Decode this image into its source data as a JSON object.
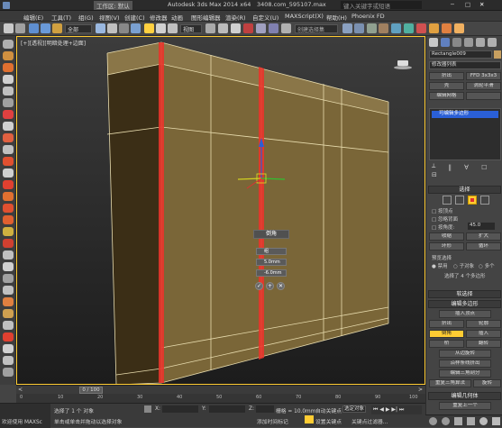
{
  "titlebar": {
    "workspace": "工作区: 默认",
    "app_title": "Autodesk 3ds Max 2014 x64",
    "file_name": "3408.com_595107.max",
    "search_placeholder": "键入关键字或短语"
  },
  "menu": [
    "编辑(E)",
    "工具(T)",
    "组(G)",
    "视图(V)",
    "创建(C)",
    "修改器",
    "动画",
    "图形编辑器",
    "渲染(R)",
    "自定义(U)",
    "MAXScript(X)",
    "帮助(H)",
    "Phoenix FD"
  ],
  "toolbar": {
    "selection_filter": "全部",
    "view_dropdown": "视图",
    "named_selection": "创建选择集"
  },
  "viewport": {
    "label": "[+][透视][明暗处理+边面]"
  },
  "caddy": {
    "title": "倒角",
    "row1": "组",
    "row2": "5.0mm",
    "row3": "-6.0mm"
  },
  "command_panel": {
    "object_name": "Rectangle009",
    "modifier_list": "修改器列表",
    "btns": [
      "挤出",
      "FFD 3x3x3",
      "壳",
      "涡轮平滑",
      "编辑网格",
      "",
      "UVW 贴图",
      ""
    ],
    "stack_item": "可编辑多边形",
    "selection_header": "选择",
    "by_vertex": "按顶点",
    "ignore_backfacing": "忽略背面",
    "by_angle": "按角度:",
    "angle_value": "45.0",
    "shrink": "收缩",
    "grow": "扩大",
    "ring": "环形",
    "loop": "循环",
    "preview_selection": "预览选择",
    "preview_off": "禁用",
    "preview_subobj": "子对象",
    "preview_multi": "多个",
    "selection_info": "选择了 4 个多边形",
    "soft_selection": "软选择",
    "edit_polygons": "编辑多边形",
    "insert_vertex": "插入顶点",
    "extrude": "挤出",
    "outline": "轮廓",
    "bevel": "倒角",
    "inset": "插入",
    "bridge": "桥",
    "flip": "翻转",
    "from_edge": "从边旋转",
    "hinge_along_spline": "沿样条线挤出",
    "edit_triangulation": "编辑三角剖分",
    "retriangulate": "重复三角算法",
    "turn": "旋转",
    "edit_geometry": "编辑几何体",
    "repeat_last": "重复上一个"
  },
  "timeline": {
    "frame": "0 / 100",
    "ticks": [
      "0",
      "10",
      "20",
      "30",
      "40",
      "50",
      "60",
      "70",
      "80",
      "90",
      "100"
    ]
  },
  "status": {
    "selected": "选择了 1 个 对象",
    "prompt": "单击或单击并拖动以选择对象",
    "welcome": "欢迎使用 MAXSc",
    "x_label": "X:",
    "y_label": "Y:",
    "z_label": "Z:",
    "grid": "栅格 = 10.0mm",
    "auto_key": "自动关键点",
    "set_key": "设置关键点",
    "key_filter": "选定对象",
    "key_filters_btn": "关键点过滤器...",
    "add_time_tag": "添加时间标记"
  },
  "colors": {
    "accent": "#ffcc33",
    "wall": "#7a6638",
    "selected_edge": "#e8352b",
    "selected_blue": "#2a5fd6"
  }
}
